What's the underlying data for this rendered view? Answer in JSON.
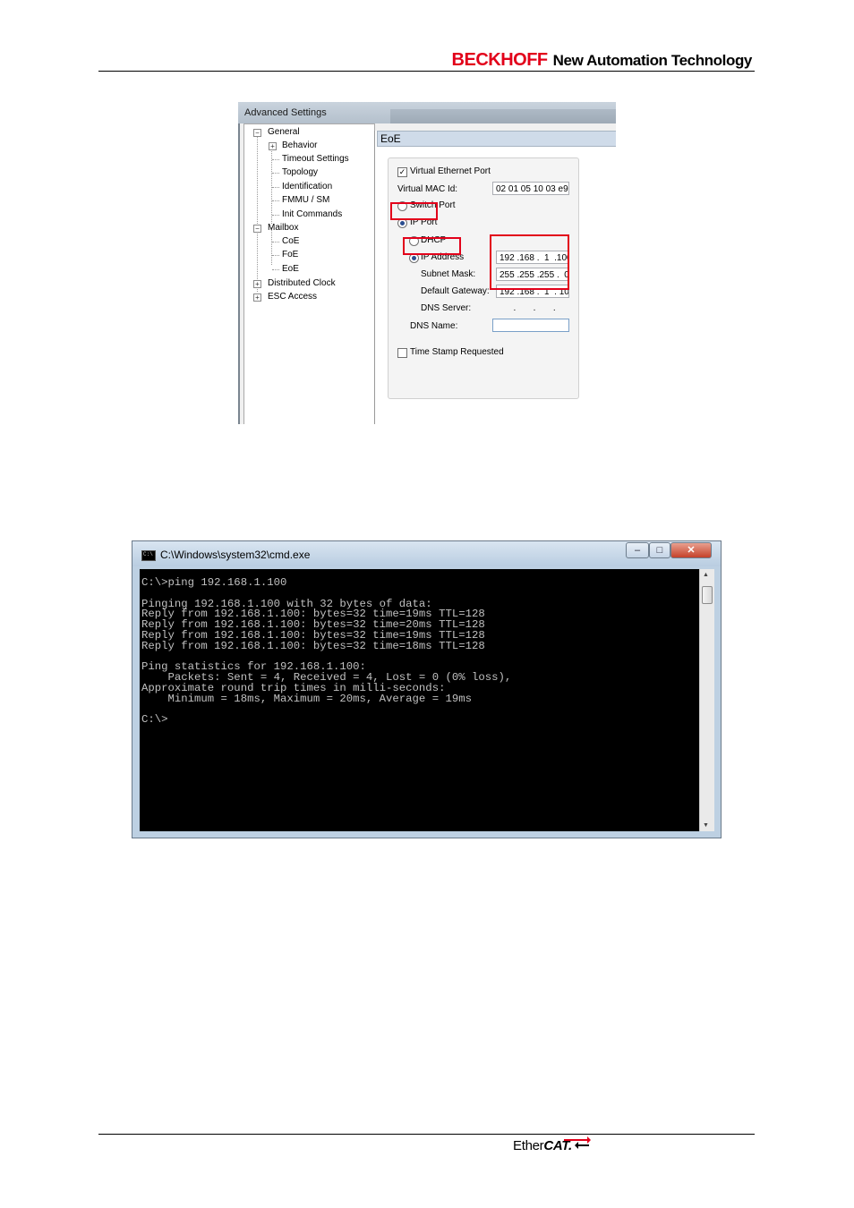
{
  "header": {
    "brand_name": "BECKHOFF",
    "brand_tagline": "New Automation Technology"
  },
  "advanced_settings": {
    "window_title": "Advanced Settings",
    "tree": [
      {
        "label": "General",
        "expander": "−"
      },
      {
        "label": "Behavior",
        "expander": "+"
      },
      {
        "label": "Timeout Settings"
      },
      {
        "label": "Topology"
      },
      {
        "label": "Identification"
      },
      {
        "label": "FMMU / SM"
      },
      {
        "label": "Init Commands"
      },
      {
        "label": "Mailbox",
        "expander": "−"
      },
      {
        "label": "CoE"
      },
      {
        "label": "FoE"
      },
      {
        "label": "EoE"
      },
      {
        "label": "Distributed Clock",
        "expander": "+"
      },
      {
        "label": "ESC Access",
        "expander": "+"
      }
    ],
    "panel_title": "EoE",
    "virtual_ethernet_port": {
      "label": "Virtual Ethernet Port",
      "checked": true
    },
    "virtual_mac_id": {
      "label": "Virtual MAC Id:",
      "value": "02 01 05 10 03 e9"
    },
    "switch_port": {
      "label": "Switch Port",
      "selected": false
    },
    "ip_port": {
      "label": "IP Port",
      "selected": true
    },
    "dhcp": {
      "label": "DHCP",
      "selected": false
    },
    "ip_address": {
      "label": "IP Address",
      "selected": true,
      "value": "192 .168 .  1  .100"
    },
    "subnet_mask": {
      "label": "Subnet Mask:",
      "value": "255 .255 .255 .  0"
    },
    "default_gateway": {
      "label": "Default Gateway:",
      "value": "192 .168 .  1  . 10"
    },
    "dns_server": {
      "label": "DNS Server:",
      "value": "       .       .       ."
    },
    "dns_name": {
      "label": "DNS Name:",
      "value": ""
    },
    "time_stamp": {
      "label": "Time Stamp Requested",
      "checked": false
    },
    "highlight_color": "#e2001a"
  },
  "cmd_window": {
    "title": "C:\\Windows\\system32\\cmd.exe",
    "icon_text": "C:\\",
    "buttons": {
      "minimize": "–",
      "maximize": "□",
      "close": "✕"
    },
    "output": "C:\\>ping 192.168.1.100\n\nPinging 192.168.1.100 with 32 bytes of data:\nReply from 192.168.1.100: bytes=32 time=19ms TTL=128\nReply from 192.168.1.100: bytes=32 time=20ms TTL=128\nReply from 192.168.1.100: bytes=32 time=19ms TTL=128\nReply from 192.168.1.100: bytes=32 time=18ms TTL=128\n\nPing statistics for 192.168.1.100:\n    Packets: Sent = 4, Received = 4, Lost = 0 (0% loss),\nApproximate round trip times in milli-seconds:\n    Minimum = 18ms, Maximum = 20ms, Average = 19ms\n\nC:\\>"
  },
  "footer": {
    "logo_part1": "Ether",
    "logo_part2": "CAT."
  }
}
